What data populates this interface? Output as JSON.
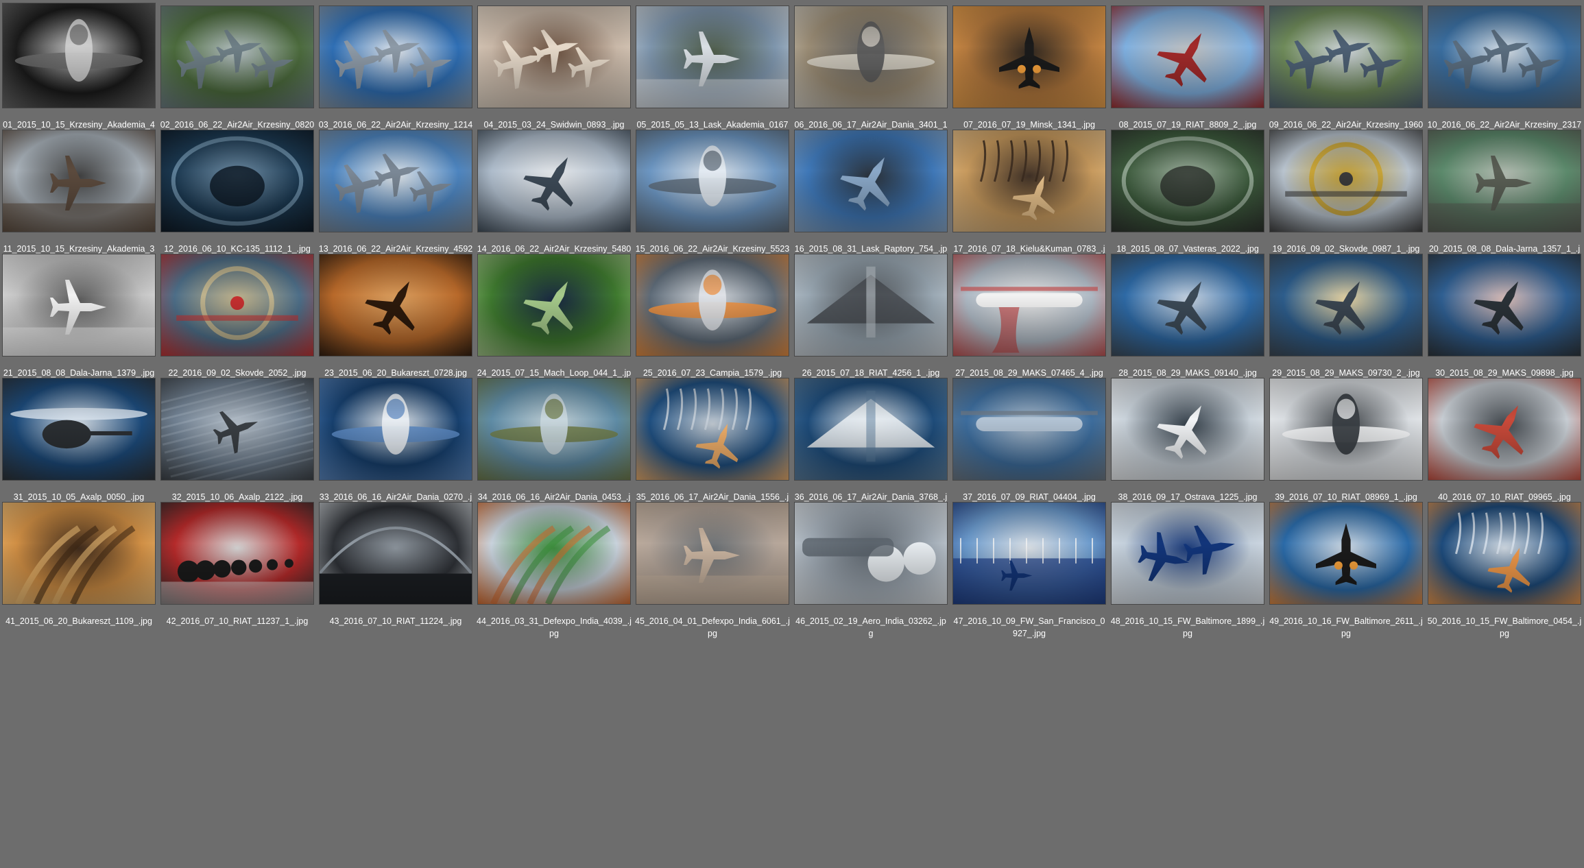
{
  "window": {
    "title": ""
  },
  "grid": {
    "items": [
      {
        "filename": "01_2015_10_15_Krzesiny_Akademia_426_1_.jpg",
        "aspect": "square-ish",
        "palette": [
          "#1a1a1a",
          "#cfcfcf",
          "#6a6a6a"
        ],
        "scene": "jet-front-dark"
      },
      {
        "filename": "02_2016_06_22_Air2Air_Krzesiny_0820_1_.jpg",
        "aspect": "landscape",
        "palette": [
          "#4c6b3d",
          "#b9c5c9",
          "#6e7f86"
        ],
        "scene": "formation-ground"
      },
      {
        "filename": "03_2016_06_22_Air2Air_Krzesiny_1214_3_.jpg",
        "aspect": "landscape",
        "palette": [
          "#2f6fb5",
          "#e8eef5",
          "#8d9aa7"
        ],
        "scene": "formation-sky"
      },
      {
        "filename": "04_2015_03_24_Swidwin_0893_.jpg",
        "aspect": "landscape",
        "palette": [
          "#c9b8a8",
          "#6b4f3c",
          "#e6d9c9"
        ],
        "scene": "formation-warm"
      },
      {
        "filename": "05_2015_05_13_Lask_Akademia_0167_.jpg",
        "aspect": "landscape",
        "palette": [
          "#7f96ad",
          "#4b5a45",
          "#d9dfe4"
        ],
        "scene": "ground-display"
      },
      {
        "filename": "06_2016_06_17_Air2Air_Dania_3401_1_.jpg",
        "aspect": "landscape",
        "palette": [
          "#9a8c75",
          "#5d5d5d",
          "#d7d2c7"
        ],
        "scene": "jet-front-warm"
      },
      {
        "filename": "07_2016_07_19_Minsk_1341_.jpg",
        "aspect": "landscape",
        "palette": [
          "#b57a3e",
          "#2b2118",
          "#f0a44b"
        ],
        "scene": "jet-rear-sunset"
      },
      {
        "filename": "08_2015_07_19_RIAT_8809_2_.jpg",
        "aspect": "landscape",
        "palette": [
          "#7fb0e0",
          "#c7c7c7",
          "#a22a2a"
        ],
        "scene": "jet-belly-sky"
      },
      {
        "filename": "09_2016_06_22_Air2Air_Krzesiny_1960_.jpg",
        "aspect": "landscape",
        "palette": [
          "#6f8b5a",
          "#d6dde4",
          "#4d6074"
        ],
        "scene": "formation-ground"
      },
      {
        "filename": "10_2016_06_22_Air2Air_Krzesiny_2317_2_1_.jpg",
        "aspect": "landscape",
        "palette": [
          "#3a6ea0",
          "#dfe8f0",
          "#5b6e80"
        ],
        "scene": "formation-sky"
      },
      {
        "filename": "11_2015_10_15_Krzesiny_Akademia_337_.jpg",
        "aspect": "landscape",
        "palette": [
          "#a9b2ba",
          "#3b3b3b",
          "#5b4a3d"
        ],
        "scene": "jet-takeoff"
      },
      {
        "filename": "12_2016_06_10_KC-135_1112_1_.jpg",
        "aspect": "landscape",
        "palette": [
          "#1b3850",
          "#6d8ea8",
          "#0a1520"
        ],
        "scene": "cockpit-blue"
      },
      {
        "filename": "13_2016_06_22_Air2Air_Krzesiny_4592_2_.jpg",
        "aspect": "landscape",
        "palette": [
          "#4d85c0",
          "#e9eff4",
          "#7b8896"
        ],
        "scene": "formation-sky"
      },
      {
        "filename": "14_2016_06_22_Air2Air_Krzesiny_5480_.jpg",
        "aspect": "landscape",
        "palette": [
          "#aebccb",
          "#f0f3f6",
          "#3d4a57"
        ],
        "scene": "jet-clouds"
      },
      {
        "filename": "15_2016_06_22_Air2Air_Krzesiny_5523_5_.jpg",
        "aspect": "landscape",
        "palette": [
          "#6c96c2",
          "#e4ebf2",
          "#5c6a78"
        ],
        "scene": "jet-front-sky"
      },
      {
        "filename": "16_2015_08_31_Lask_Raptory_754_.jpg",
        "aspect": "landscape",
        "palette": [
          "#3f78b8",
          "#232b34",
          "#8aa8c8"
        ],
        "scene": "jet-top-blue"
      },
      {
        "filename": "17_2016_07_18_Kielu&Kuman_0783_.jpg",
        "aspect": "landscape",
        "palette": [
          "#c79a5e",
          "#3a2a1e",
          "#e8c28c"
        ],
        "scene": "flares"
      },
      {
        "filename": "18_2015_08_07_Vasteras_2022_.jpg",
        "aspect": "landscape",
        "palette": [
          "#3c5a3c",
          "#9fb3a0",
          "#2a2f2a"
        ],
        "scene": "canopy"
      },
      {
        "filename": "19_2016_09_02_Skovde_0987_1_.jpg",
        "aspect": "landscape",
        "palette": [
          "#b9c4cf",
          "#c9a12a",
          "#3a3a3a"
        ],
        "scene": "biplane"
      },
      {
        "filename": "20_2015_08_08_Dala-Jarna_1357_1_.jpg",
        "aspect": "landscape",
        "palette": [
          "#5c8a6c",
          "#b9c2b7",
          "#5a5f55"
        ],
        "scene": "warbird-green"
      },
      {
        "filename": "21_2015_08_08_Dala-Jarna_1379_.jpg",
        "aspect": "landscape",
        "palette": [
          "#c4c4c4",
          "#5a5a5a",
          "#f2f2f2"
        ],
        "scene": "warbird-silver"
      },
      {
        "filename": "22_2016_09_02_Skovde_2052_.jpg",
        "aspect": "landscape",
        "palette": [
          "#4d6e88",
          "#c8b98e",
          "#c63030"
        ],
        "scene": "warbird-prop"
      },
      {
        "filename": "23_2015_06_20_Bukareszt_0728.jpg",
        "aspect": "landscape",
        "palette": [
          "#b8692a",
          "#e4a25c",
          "#2d1a0c"
        ],
        "scene": "jet-silhouette-orange"
      },
      {
        "filename": "24_2015_07_15_Mach_Loop_044_1_.jpg",
        "aspect": "landscape",
        "palette": [
          "#3f7a2f",
          "#0f1f3c",
          "#a5c98a"
        ],
        "scene": "jet-lowlevel-green"
      },
      {
        "filename": "25_2016_07_23_Campia_1579_.jpg",
        "aspect": "landscape",
        "palette": [
          "#5e6b78",
          "#dfe3e8",
          "#f08f3c"
        ],
        "scene": "jet-front-grey"
      },
      {
        "filename": "26_2015_07_18_RIAT_4256_1_.jpg",
        "aspect": "landscape",
        "palette": [
          "#9aa8b3",
          "#4a4f54",
          "#d0d7dd"
        ],
        "scene": "vulcan"
      },
      {
        "filename": "27_2015_08_29_MAKS_07465_4_.jpg",
        "aspect": "landscape",
        "palette": [
          "#aeb9c4",
          "#f2f2f2",
          "#c55050"
        ],
        "scene": "water-bomber"
      },
      {
        "filename": "28_2015_08_29_MAKS_09140_.jpg",
        "aspect": "landscape",
        "palette": [
          "#2e6aa6",
          "#cfdceb",
          "#3c4a57"
        ],
        "scene": "jet-vapor-blue"
      },
      {
        "filename": "29_2015_08_29_MAKS_09730_2_.jpg",
        "aspect": "landscape",
        "palette": [
          "#2d5d8c",
          "#f1dca6",
          "#3b4651"
        ],
        "scene": "jet-vapor-gold"
      },
      {
        "filename": "30_2015_08_29_MAKS_09898_.jpg",
        "aspect": "landscape",
        "palette": [
          "#2f5f92",
          "#e3c3bd",
          "#2b3238"
        ],
        "scene": "jet-vapor-pink"
      },
      {
        "filename": "31_2015_10_05_Axalp_0050_.jpg",
        "aspect": "landscape",
        "palette": [
          "#1c4a7a",
          "#d8e2ec",
          "#2b2f33"
        ],
        "scene": "helicopter"
      },
      {
        "filename": "32_2015_10_06_Axalp_2122_.jpg",
        "aspect": "landscape",
        "palette": [
          "#6f7f90",
          "#b9c4cf",
          "#3a3f44"
        ],
        "scene": "jet-motion"
      },
      {
        "filename": "33_2016_06_16_Air2Air_Dania_0270_.jpg",
        "aspect": "landscape",
        "palette": [
          "#17406e",
          "#e9eef3",
          "#5a88c2"
        ],
        "scene": "jet-front-blue"
      },
      {
        "filename": "34_2016_06_16_Air2Air_Dania_0453_.jpg",
        "aspect": "landscape",
        "palette": [
          "#5f8ca6",
          "#c8d7dd",
          "#6e7b48"
        ],
        "scene": "jet-front-coast"
      },
      {
        "filename": "35_2016_06_17_Air2Air_Dania_1556_.jpg",
        "aspect": "landscape",
        "palette": [
          "#1f4f80",
          "#c8d1da",
          "#f2b06a"
        ],
        "scene": "jet-flare-blue"
      },
      {
        "filename": "36_2016_06_17_Air2Air_Dania_3768_.jpg",
        "aspect": "landscape",
        "palette": [
          "#1e4c7a",
          "#e7ecf1",
          "#5b7e9d"
        ],
        "scene": "delta-top"
      },
      {
        "filename": "37_2016_07_09_RIAT_04404_.jpg",
        "aspect": "landscape",
        "palette": [
          "#3d6d9d",
          "#b2c3d4",
          "#6d7883"
        ],
        "scene": "transport"
      },
      {
        "filename": "38_2016_09_17_Ostrava_1225_.jpg",
        "aspect": "landscape",
        "palette": [
          "#c9d2da",
          "#2e3a45",
          "#f2f4f6"
        ],
        "scene": "jet-close-grey"
      },
      {
        "filename": "39_2016_07_10_RIAT_08969_1_.jpg",
        "aspect": "landscape",
        "palette": [
          "#d9dde1",
          "#3a3f44",
          "#f7f8f9"
        ],
        "scene": "f35-front"
      },
      {
        "filename": "40_2016_07_10_RIAT_09965_.jpg",
        "aspect": "landscape",
        "palette": [
          "#c7cdd3",
          "#3b4147",
          "#c94a3a"
        ],
        "scene": "jet-dark-light"
      },
      {
        "filename": "41_2015_06_20_Bukareszt_1109_.jpg",
        "aspect": "landscape",
        "palette": [
          "#d08f45",
          "#3a2413",
          "#f3c27a"
        ],
        "scene": "smoke-trails"
      },
      {
        "filename": "42_2016_07_10_RIAT_11237_1_.jpg",
        "aspect": "landscape",
        "palette": [
          "#b52a2a",
          "#dedede",
          "#2a2a2a"
        ],
        "scene": "wheels-line"
      },
      {
        "filename": "43_2016_07_10_RIAT_11224_.jpg",
        "aspect": "landscape",
        "palette": [
          "#2d3035",
          "#8f98a1",
          "#d5dade"
        ],
        "scene": "hangar-night"
      },
      {
        "filename": "44_2016_03_31_Defexpo_India_4039_.jpg",
        "aspect": "landscape",
        "palette": [
          "#c8d2dc",
          "#3a8f3a",
          "#d86a2a"
        ],
        "scene": "tricolor-smoke"
      },
      {
        "filename": "45_2016_04_01_Defexpo_India_6061_.jpg",
        "aspect": "landscape",
        "palette": [
          "#b5a69a",
          "#6a7075",
          "#c9b4a0"
        ],
        "scene": "jet-ground-dusk"
      },
      {
        "filename": "46_2015_02_19_Aero_India_03262_.jpg",
        "aspect": "landscape",
        "palette": [
          "#a4aeb8",
          "#5a636c",
          "#e6ebef"
        ],
        "scene": "jet-engines"
      },
      {
        "filename": "47_2016_10_09_FW_San_Francisco_0927_.jpg",
        "aspect": "landscape",
        "palette": [
          "#6b9acc",
          "#e5ebf1",
          "#1f3f86"
        ],
        "scene": "blue-angels-sea"
      },
      {
        "filename": "48_2016_10_15_FW_Baltimore_1899_.jpg",
        "aspect": "landscape",
        "palette": [
          "#c3cfdb",
          "#12357a",
          "#e6ecf2"
        ],
        "scene": "blue-angels-pair"
      },
      {
        "filename": "49_2016_10_16_FW_Baltimore_2611_.jpg",
        "aspect": "landscape",
        "palette": [
          "#2a6aa8",
          "#d6e2ee",
          "#e98a3a"
        ],
        "scene": "jet-rear-afterburner"
      },
      {
        "filename": "50_2016_10_15_FW_Baltimore_0454_.jpg",
        "aspect": "landscape",
        "palette": [
          "#1d4b7c",
          "#d8e2ec",
          "#f29a4a"
        ],
        "scene": "raptor-flares"
      }
    ]
  }
}
